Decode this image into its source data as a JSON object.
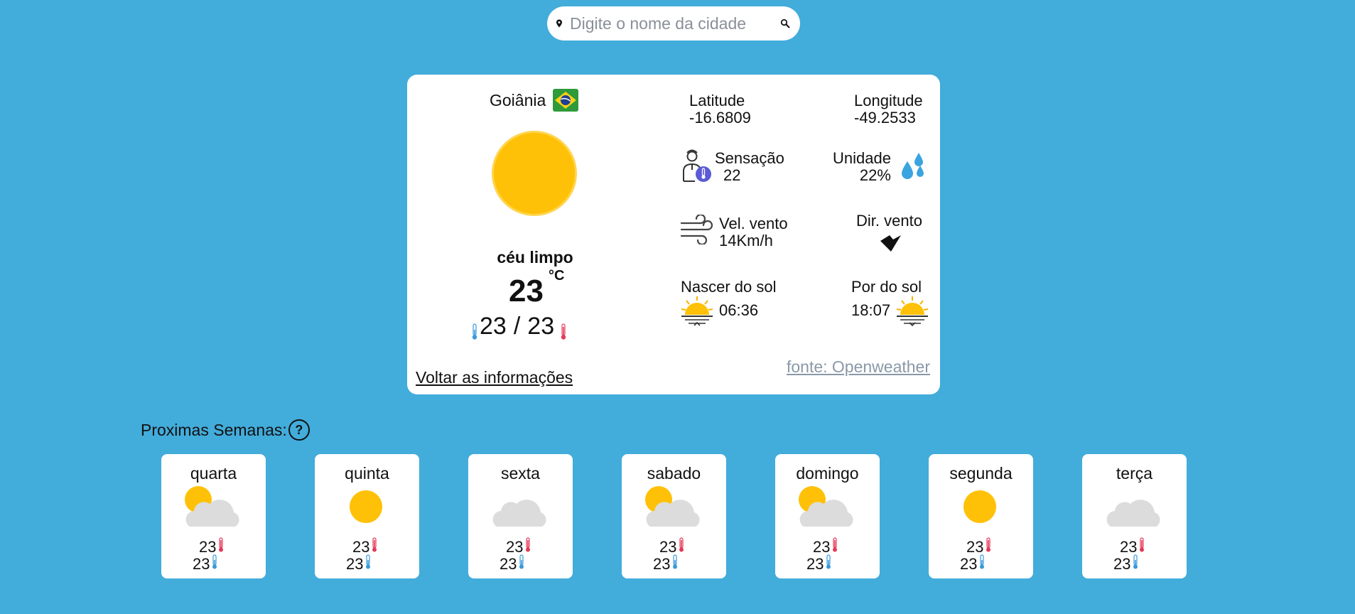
{
  "search": {
    "placeholder": "Digite o nome da cidade"
  },
  "current": {
    "city": "Goiânia",
    "description": "céu limpo",
    "temperature": "23",
    "unit": "°C",
    "min": "23",
    "separator": "/",
    "max": "23",
    "back_link": "Voltar as informações",
    "source_link": "fonte: Openweather"
  },
  "details": {
    "latitude_label": "Latitude",
    "latitude_value": "-16.6809",
    "longitude_label": "Longitude",
    "longitude_value": "-49.2533",
    "feels_label": "Sensação",
    "feels_value": "22",
    "humidity_label": "Unidade",
    "humidity_value": "22%",
    "wind_speed_label": "Vel. vento",
    "wind_speed_value": "14Km/h",
    "wind_dir_label": "Dir. vento",
    "sunrise_label": "Nascer do sol",
    "sunrise_value": "06:36",
    "sunset_label": "Por do sol",
    "sunset_value": "18:07"
  },
  "forecast": {
    "title": "Proximas Semanas:",
    "help": "?",
    "days": [
      {
        "name": "quarta",
        "icon": "sun-behind-cloud-icon",
        "max": "23",
        "min": "23"
      },
      {
        "name": "quinta",
        "icon": "sun-icon",
        "max": "23",
        "min": "23"
      },
      {
        "name": "sexta",
        "icon": "moon-behind-cloud-icon",
        "max": "23",
        "min": "23"
      },
      {
        "name": "sabado",
        "icon": "sun-behind-cloud-icon",
        "max": "23",
        "min": "23"
      },
      {
        "name": "domingo",
        "icon": "sun-behind-cloud-icon",
        "max": "23",
        "min": "23"
      },
      {
        "name": "segunda",
        "icon": "sun-icon",
        "max": "23",
        "min": "23"
      },
      {
        "name": "terça",
        "icon": "moon-behind-cloud-icon",
        "max": "23",
        "min": "23"
      }
    ]
  },
  "colors": {
    "background": "#42acdb",
    "sun": "#ffc107",
    "cloud": "#dcdcdc",
    "moon": "#1e88c8",
    "hot": "#e53958",
    "cold": "#3a9ad9"
  }
}
